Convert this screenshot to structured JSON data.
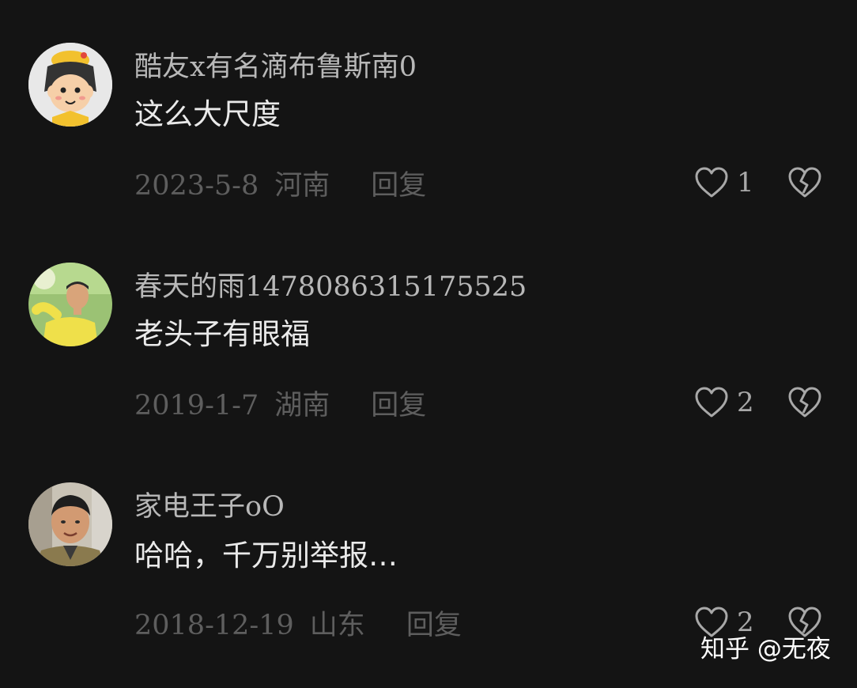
{
  "comments": [
    {
      "username": "酷友x有名滴布鲁斯南0",
      "content": "这么大尺度",
      "date": "2023-5-8",
      "region": "河南",
      "reply_label": "回复",
      "likes": "1",
      "avatar_icon": "cartoon-monkey-avatar"
    },
    {
      "username": "春天的雨1478086315175525",
      "content": "老头子有眼福",
      "date": "2019-1-7",
      "region": "湖南",
      "reply_label": "回复",
      "likes": "2",
      "avatar_icon": "man-yellow-shirt-avatar"
    },
    {
      "username": "家电王子oO",
      "content": "哈哈，千万别举报…",
      "date": "2018-12-19",
      "region": "山东",
      "reply_label": "回复",
      "likes": "2",
      "avatar_icon": "man-portrait-avatar"
    }
  ],
  "icons": {
    "like": "heart-icon",
    "dislike": "broken-heart-icon"
  },
  "watermark": "知乎 @无夜",
  "colors": {
    "background": "#141414",
    "username": "#b8b8b8",
    "content": "#eaeaea",
    "meta": "#5e5e5e",
    "icon": "#a8a8a8"
  }
}
